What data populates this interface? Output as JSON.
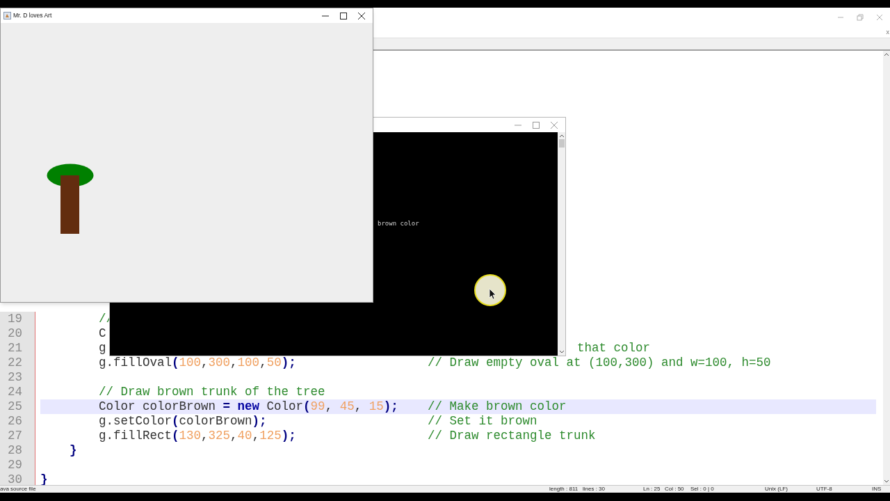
{
  "art_window": {
    "title": "Mr. D loves Art"
  },
  "console_window": {
    "output": "brown color"
  },
  "editor": {
    "tab_close": "x",
    "lines": [
      {
        "number": "19",
        "current": false,
        "tokens": [
          {
            "kind": "comment",
            "text": "        //"
          }
        ]
      },
      {
        "number": "20",
        "current": false,
        "tokens": [
          {
            "kind": "plain",
            "text": "        C"
          }
        ]
      },
      {
        "number": "21",
        "current": false,
        "tokens": [
          {
            "kind": "plain",
            "text": "        g"
          }
        ],
        "partial_comment": "that color"
      },
      {
        "number": "22",
        "current": false,
        "tokens": [
          {
            "kind": "plain",
            "text": "        g.fillOval"
          },
          {
            "kind": "op",
            "text": "("
          },
          {
            "kind": "number",
            "text": "100"
          },
          {
            "kind": "plain",
            "text": ","
          },
          {
            "kind": "number",
            "text": "300"
          },
          {
            "kind": "plain",
            "text": ","
          },
          {
            "kind": "number",
            "text": "100"
          },
          {
            "kind": "plain",
            "text": ","
          },
          {
            "kind": "number",
            "text": "50"
          },
          {
            "kind": "op",
            "text": ");"
          }
        ],
        "comment": "// Draw empty oval at (100,300) and w=100, h=50"
      },
      {
        "number": "23",
        "current": false
      },
      {
        "number": "24",
        "current": false,
        "tokens": [
          {
            "kind": "comment",
            "text": "        // Draw brown trunk of the tree"
          }
        ]
      },
      {
        "number": "25",
        "current": true,
        "tokens": [
          {
            "kind": "plain",
            "text": "        Color colorBrown "
          },
          {
            "kind": "op",
            "text": "= "
          },
          {
            "kind": "keyword",
            "text": "new"
          },
          {
            "kind": "plain",
            "text": " Color"
          },
          {
            "kind": "op",
            "text": "("
          },
          {
            "kind": "number",
            "text": "99"
          },
          {
            "kind": "plain",
            "text": ", "
          },
          {
            "kind": "number",
            "text": "45"
          },
          {
            "kind": "plain",
            "text": ", "
          },
          {
            "kind": "number",
            "text": "15"
          },
          {
            "kind": "op",
            "text": ");"
          }
        ],
        "comment": "// Make brown color"
      },
      {
        "number": "26",
        "current": false,
        "tokens": [
          {
            "kind": "plain",
            "text": "        g.setColor"
          },
          {
            "kind": "op",
            "text": "("
          },
          {
            "kind": "plain",
            "text": "colorBrown"
          },
          {
            "kind": "op",
            "text": ");"
          }
        ],
        "comment": "// Set it brown"
      },
      {
        "number": "27",
        "current": false,
        "tokens": [
          {
            "kind": "plain",
            "text": "        g.fillRect"
          },
          {
            "kind": "op",
            "text": "("
          },
          {
            "kind": "number",
            "text": "130"
          },
          {
            "kind": "plain",
            "text": ","
          },
          {
            "kind": "number",
            "text": "325"
          },
          {
            "kind": "plain",
            "text": ","
          },
          {
            "kind": "number",
            "text": "40"
          },
          {
            "kind": "plain",
            "text": ","
          },
          {
            "kind": "number",
            "text": "125"
          },
          {
            "kind": "op",
            "text": ");"
          }
        ],
        "comment": "// Draw rectangle trunk"
      },
      {
        "number": "28",
        "current": false,
        "tokens": [
          {
            "kind": "op",
            "text": "    }"
          }
        ]
      },
      {
        "number": "29",
        "current": false
      },
      {
        "number": "30",
        "current": false,
        "tokens": [
          {
            "kind": "op",
            "text": "}"
          }
        ]
      }
    ],
    "status_bar": [
      "ava source file",
      "length : 811",
      "lines : 30",
      "Ln : 25",
      "Col : 50",
      "Sel : 0 | 0",
      "Unix (LF)",
      "UTF-8",
      "INS"
    ]
  }
}
